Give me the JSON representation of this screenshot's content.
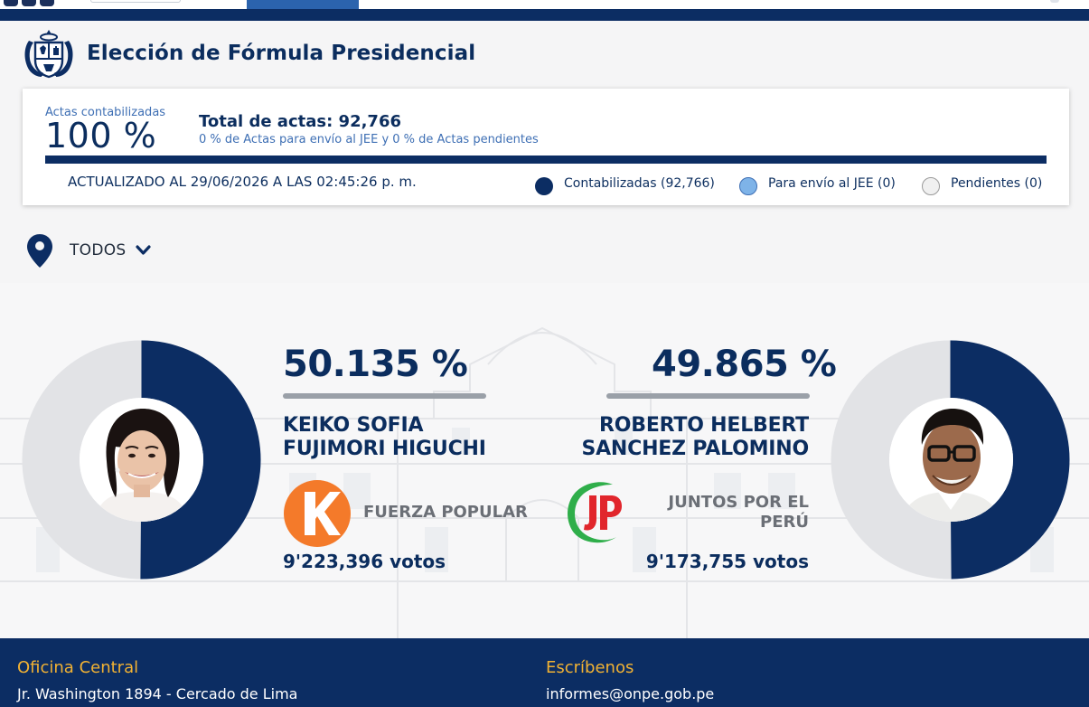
{
  "page": {
    "title": "Elección de Fórmula Presidencial"
  },
  "actas": {
    "label": "Actas contabilizadas",
    "percent": "100 %",
    "total": "Total de actas: 92,766",
    "subtitle": "0 % de Actas para envío al JEE y 0 % de Actas pendientes",
    "updated": "ACTUALIZADO AL 29/06/2026 A LAS 02:45:26 p. m.",
    "legend": [
      {
        "label": "Contabilizadas (92,766)",
        "color": "#0c2d63"
      },
      {
        "label": "Para envío al JEE (0)",
        "color": "#7eb3e8"
      },
      {
        "label": "Pendientes (0)",
        "color": "#f0f0f0"
      }
    ]
  },
  "filter": {
    "location": "TODOS"
  },
  "candidates": [
    {
      "percent": "50.135 %",
      "share": 0.50135,
      "name_line1": "KEIKO SOFIA",
      "name_line2": "FUJIMORI HIGUCHI",
      "party": "FUERZA POPULAR",
      "votes": "9'223,396 votos",
      "party_color": "#f47a2a"
    },
    {
      "percent": "49.865 %",
      "share": 0.49865,
      "name_line1": "ROBERTO HELBERT",
      "name_line2": "SANCHEZ PALOMINO",
      "party_line1": "JUNTOS POR EL",
      "party_line2": "PERÚ",
      "votes": "9'173,755 votos",
      "party_color": "#2fae4a"
    }
  ],
  "footer": {
    "office_heading": "Oficina Central",
    "office_address": "Jr. Washington 1894 - Cercado de Lima",
    "contact_heading": "Escríbenos",
    "contact_email": "informes@onpe.gob.pe"
  },
  "colors": {
    "primary": "#0c2d63",
    "accent": "#2b63ad",
    "footer_heading": "#f2b233",
    "donut_rest": "#e2e3e6"
  }
}
